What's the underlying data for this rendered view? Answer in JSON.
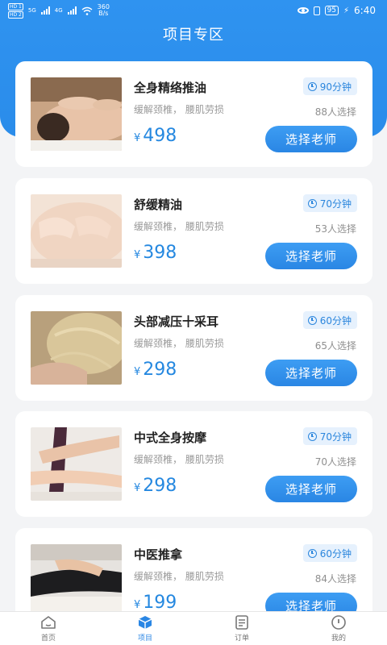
{
  "status_bar": {
    "sim1": "HD 1",
    "sim2": "HD 2",
    "net1": "5G",
    "net2": "4G",
    "speed": "360",
    "speed_unit": "B/s",
    "battery": "95",
    "time": "6:40"
  },
  "page_title": "项目专区",
  "currency": "¥",
  "choose_label": "选择老师",
  "items": [
    {
      "title": "全身精络推油",
      "subtitle": "缓解颈椎，  腰肌劳损",
      "duration": "90分钟",
      "chosen": "88人选择",
      "price": "498"
    },
    {
      "title": "舒缓精油",
      "subtitle": "缓解颈椎，  腰肌劳损",
      "duration": "70分钟",
      "chosen": "53人选择",
      "price": "398"
    },
    {
      "title": "头部减压十采耳",
      "subtitle": "缓解颈椎，  腰肌劳损",
      "duration": "60分钟",
      "chosen": "65人选择",
      "price": "298"
    },
    {
      "title": "中式全身按摩",
      "subtitle": "缓解颈椎，  腰肌劳损",
      "duration": "70分钟",
      "chosen": "70人选择",
      "price": "298"
    },
    {
      "title": "中医推拿",
      "subtitle": "缓解颈椎，  腰肌劳损",
      "duration": "60分钟",
      "chosen": "84人选择",
      "price": "199"
    }
  ],
  "tabbar": {
    "home": {
      "label": "首页",
      "icon": "home-icon"
    },
    "projects": {
      "label": "项目",
      "icon": "cube-icon"
    },
    "orders": {
      "label": "订单",
      "icon": "order-icon"
    },
    "mine": {
      "label": "我的",
      "icon": "user-icon"
    }
  },
  "colors": {
    "primary": "#2a86e4",
    "header": "#2f93f0",
    "price": "#2588e0",
    "badge_bg": "#e6f1fd"
  }
}
